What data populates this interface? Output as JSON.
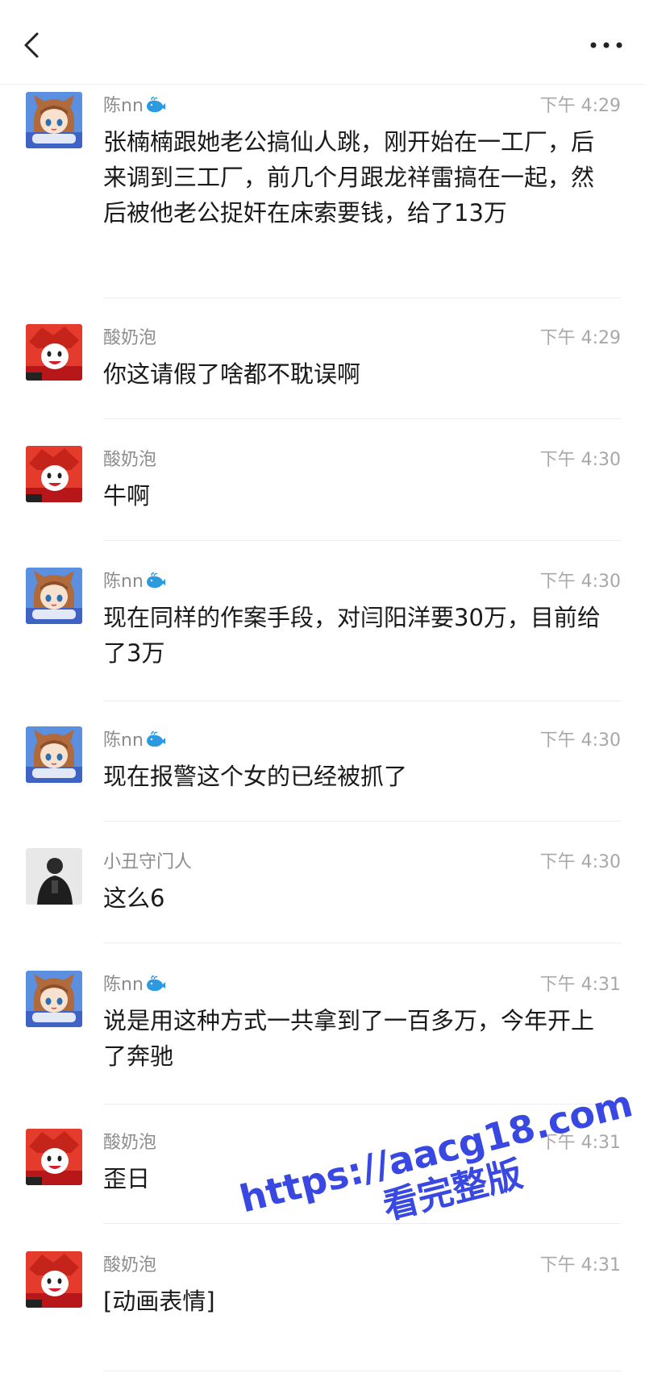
{
  "header": {
    "back_icon": "chevron-left-icon",
    "more_icon": "more-horizontal-icon"
  },
  "messages": [
    {
      "name": "陈nn",
      "badge_icon": "whale-icon",
      "time": "下午 4:29",
      "text": "张楠楠跟她老公搞仙人跳，刚开始在一工厂，后来调到三工厂，前几个月跟龙祥雷搞在一起，然后被他老公捉奸在床索要钱，给了13万",
      "avatar": "anime-girl-avatar"
    },
    {
      "name": "酸奶泡",
      "time": "下午 4:29",
      "text": "你这请假了啥都不耽误啊",
      "avatar": "red-hair-cartoon-avatar"
    },
    {
      "name": "酸奶泡",
      "time": "下午 4:30",
      "text": "牛啊",
      "avatar": "red-hair-cartoon-avatar"
    },
    {
      "name": "陈nn",
      "badge_icon": "whale-icon",
      "time": "下午 4:30",
      "text": "现在同样的作案手段，对闫阳洋要30万，目前给了3万",
      "avatar": "anime-girl-avatar"
    },
    {
      "name": "陈nn",
      "badge_icon": "whale-icon",
      "time": "下午 4:30",
      "text": "现在报警这个女的已经被抓了",
      "avatar": "anime-girl-avatar"
    },
    {
      "name": "小丑守门人",
      "time": "下午 4:30",
      "text": "这么6",
      "avatar": "dark-photo-avatar"
    },
    {
      "name": "陈nn",
      "badge_icon": "whale-icon",
      "time": "下午 4:31",
      "text": "说是用这种方式一共拿到了一百多万，今年开上了奔驰",
      "avatar": "anime-girl-avatar"
    },
    {
      "name": "酸奶泡",
      "time": "下午 4:31",
      "text": "歪日",
      "avatar": "red-hair-cartoon-avatar"
    },
    {
      "name": "酸奶泡",
      "time": "下午 4:31",
      "text": "[动画表情]",
      "avatar": "red-hair-cartoon-avatar"
    }
  ],
  "watermark": {
    "url": "https://aacg18.com",
    "subtitle": "看完整版"
  },
  "colors": {
    "name_gray": "#8c8c8c",
    "time_gray": "#a8a8a8",
    "watermark_blue": "#3848e0"
  }
}
